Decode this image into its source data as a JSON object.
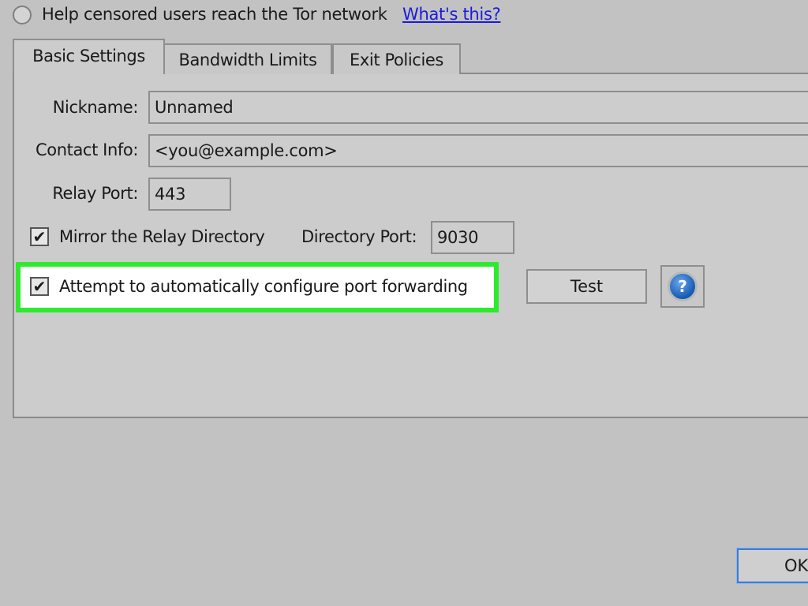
{
  "top": {
    "radio_label": "Help censored users reach the Tor network",
    "radio_selected": false,
    "help_link": "What's this?"
  },
  "tabs": [
    {
      "label": "Basic Settings",
      "active": true
    },
    {
      "label": "Bandwidth Limits",
      "active": false
    },
    {
      "label": "Exit Policies",
      "active": false
    }
  ],
  "basic": {
    "nickname_label": "Nickname:",
    "nickname_value": "Unnamed",
    "contact_label": "Contact Info:",
    "contact_value": "<you@example.com>",
    "relay_port_label": "Relay Port:",
    "relay_port_value": "443",
    "mirror_label": "Mirror the Relay Directory",
    "mirror_checked": true,
    "dir_port_label": "Directory Port:",
    "dir_port_value": "9030",
    "port_forward_label": "Attempt to automatically configure port forwarding",
    "port_forward_checked": true,
    "test_button": "Test",
    "help_icon": "help-question-icon"
  },
  "footer": {
    "ok_button": "OK"
  },
  "colors": {
    "highlight": "#2eea2e",
    "link": "#1a1ae0",
    "help_icon_blue": "#1a5fb8"
  }
}
